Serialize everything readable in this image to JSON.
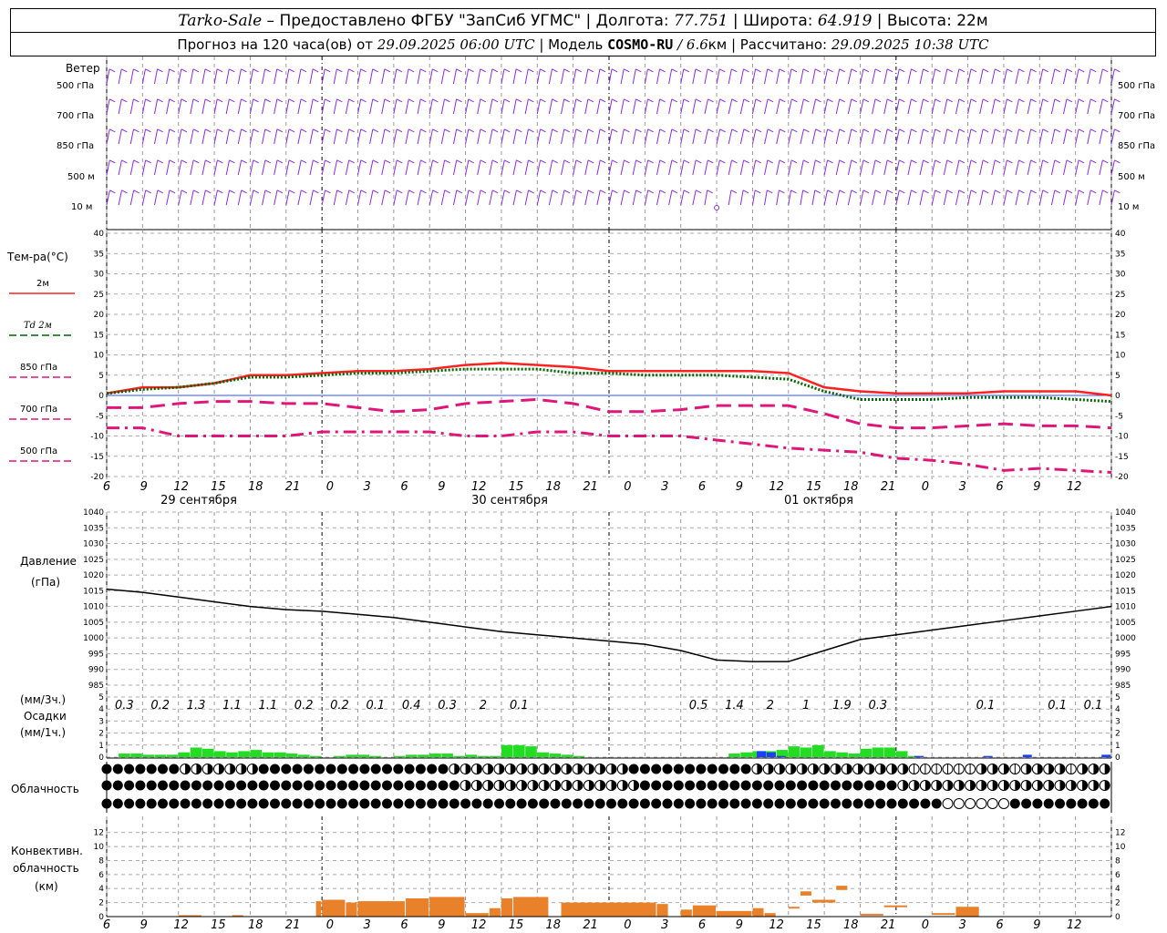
{
  "header": {
    "station": "Tarko-Sale",
    "provider": " – Предоставлено ФГБУ \"ЗапСиб УГМС\" | ",
    "lon_label": "Долгота: ",
    "lon": "77.751",
    "lat_label": " | Широта: ",
    "lat": "64.919",
    "alt_label": " | Высота: ",
    "alt": "22м",
    "forecast_label": "Прогноз на 120 часа(ов) от ",
    "forecast_time": "29.09.2025 06:00 UTC",
    "model_label": "  | Модель ",
    "model": "COSMO-RU",
    "res_sep": " / ",
    "res": "6.6",
    "res_unit": "км",
    "calc_label": " | Рассчитано: ",
    "calc_time": "29.09.2025 10:38 UTC"
  },
  "colors": {
    "wind": "#8a2be2",
    "t2m": "#ff2020",
    "td2m": "#006400",
    "t850": "#e0157a",
    "precip3": "#22dd22",
    "precip1": "#1a3fff",
    "convective": "#e8812a",
    "pressure": "#000000"
  },
  "panels": {
    "wind": {
      "title": "Ветер",
      "levels": [
        "500 гПа",
        "700 гПа",
        "850 гПа",
        "500 м",
        "10  м"
      ]
    },
    "temperature": {
      "title": "Тем-ра(°C)",
      "legend": [
        {
          "label": "2м",
          "style": "solid",
          "color": "#ff2020"
        },
        {
          "label": "Td  2м",
          "style": "dotted",
          "color": "#006400"
        },
        {
          "label": "850 гПа",
          "style": "solid",
          "color": "#e0157a"
        },
        {
          "label": "700 гПа",
          "style": "longdash",
          "color": "#e0157a"
        },
        {
          "label": "500 гПа",
          "style": "dashdot",
          "color": "#e0157a"
        }
      ]
    },
    "pressure": {
      "title": "Давление",
      "unit": "(гПа)"
    },
    "precip": {
      "unit3": "(мм/3ч.)",
      "title": "Осадки",
      "unit1": "(мм/1ч.)"
    },
    "clouds": {
      "title": "Облачность"
    },
    "convective": {
      "title": "Конвективн.",
      "title2": "облачность",
      "unit": "(км)"
    }
  },
  "x_axis": {
    "hour_labels": [
      "6",
      "9",
      "12",
      "15",
      "18",
      "21",
      "0",
      "3",
      "6",
      "9",
      "12",
      "15",
      "18",
      "21",
      "0",
      "3",
      "6",
      "9",
      "12",
      "15",
      "18",
      "21",
      "0",
      "3",
      "6",
      "9",
      "12"
    ],
    "date_labels": [
      "29 сентября",
      "30 сентября",
      "01 октября"
    ]
  },
  "chart_data": [
    {
      "type": "line",
      "title": "Тем-ра(°C)",
      "ylim": [
        -20,
        40
      ],
      "yticks": [
        -20,
        -15,
        -10,
        -5,
        0,
        5,
        10,
        15,
        20,
        25,
        30,
        35,
        40
      ],
      "x": [
        0,
        3,
        6,
        9,
        12,
        15,
        18,
        21,
        24,
        27,
        30,
        33,
        36,
        39,
        42,
        45,
        48,
        51,
        54,
        57,
        60,
        63,
        66,
        69,
        72,
        75,
        78
      ],
      "series": [
        {
          "name": "2м",
          "values": [
            0.5,
            2,
            2,
            3,
            5,
            5,
            5.5,
            6,
            6,
            6.5,
            7.5,
            8,
            7.5,
            7,
            6,
            6,
            6,
            6,
            6,
            5.5,
            2,
            1,
            0.5,
            0.5,
            0.5,
            1,
            1,
            1,
            0
          ]
        },
        {
          "name": "Td  2м",
          "values": [
            0.5,
            1.5,
            2,
            3,
            4.5,
            4.5,
            5,
            5.5,
            5.5,
            6,
            6.5,
            6.5,
            6.5,
            5.5,
            5.5,
            5,
            5,
            5,
            4.5,
            4,
            1,
            -1,
            -1,
            -1,
            -0.5,
            -0.5,
            -0.5,
            -1,
            -1.5
          ]
        },
        {
          "name": "850 гПа",
          "values": [
            -3,
            -3,
            -2,
            -1.5,
            -1.5,
            -2,
            -2,
            -3,
            -4,
            -3.5,
            -2,
            -1.5,
            -1,
            -2,
            -4,
            -4,
            -3.5,
            -2.5,
            -2.5,
            -2.5,
            -4.5,
            -7,
            -8,
            -8,
            -7.5,
            -7,
            -7.5,
            -7.5,
            -8
          ]
        },
        {
          "name": "700 гПа",
          "values": [
            -3,
            -3,
            -2,
            -1.5,
            -1.5,
            -2,
            -2,
            -3,
            -4,
            -3.5,
            -2,
            -1.5,
            -1,
            -2,
            -4,
            -4,
            -3.5,
            -2.5,
            -2.5,
            -2.5,
            -4.5,
            -7,
            -8,
            -8,
            -7.5,
            -7,
            -7.5,
            -7.5,
            -8
          ]
        },
        {
          "name": "500 гПа",
          "values": [
            -8,
            -8,
            -10,
            -10,
            -10,
            -10,
            -9,
            -9,
            -9,
            -9,
            -10,
            -10,
            -9,
            -9,
            -10,
            -10,
            -10,
            -11,
            -12,
            -13,
            -13.5,
            -14,
            -15.5,
            -16,
            -17,
            -18.5,
            -18,
            -18.5,
            -19
          ]
        }
      ],
      "x_hours": [
        0,
        3,
        6,
        9,
        12,
        15,
        18,
        21,
        24,
        27,
        30,
        33,
        36,
        39,
        42,
        45,
        48,
        51,
        54,
        57,
        60,
        63,
        66,
        69,
        72,
        75,
        78,
        81,
        84
      ]
    },
    {
      "type": "line",
      "title": "Давление",
      "ylabel": "(гПа)",
      "ylim": [
        985,
        1040
      ],
      "yticks": [
        985,
        990,
        995,
        1000,
        1005,
        1010,
        1015,
        1020,
        1025,
        1030,
        1035,
        1040
      ],
      "x_hours": [
        0,
        3,
        6,
        9,
        12,
        15,
        18,
        21,
        24,
        27,
        30,
        33,
        36,
        39,
        42,
        45,
        48,
        51,
        54,
        57,
        60,
        63,
        66,
        69,
        72,
        75,
        78,
        81,
        84
      ],
      "series": [
        {
          "name": "",
          "values": [
            1015.5,
            1014.5,
            1013,
            1011.5,
            1010,
            1009,
            1008.5,
            1007.5,
            1006.5,
            1005,
            1003.5,
            1002,
            1001,
            1000,
            999,
            998,
            996,
            993,
            992.5,
            992.5,
            996,
            999.5,
            1001,
            1002.5,
            1004,
            1005.5,
            1007,
            1008.5,
            1010
          ]
        }
      ]
    },
    {
      "type": "bar",
      "title": "Осадки",
      "ylim": [
        0,
        5
      ],
      "yticks": [
        0,
        1,
        2,
        3,
        4,
        5
      ],
      "labels_3h": [
        {
          "hour": 3,
          "value": "0.3"
        },
        {
          "hour": 6,
          "value": "0.2"
        },
        {
          "hour": 9,
          "value": "1.3"
        },
        {
          "hour": 12,
          "value": "1.1"
        },
        {
          "hour": 15,
          "value": "1.1"
        },
        {
          "hour": 18,
          "value": "0.2"
        },
        {
          "hour": 21,
          "value": "0.2"
        },
        {
          "hour": 24,
          "value": "0.1"
        },
        {
          "hour": 27,
          "value": "0.4"
        },
        {
          "hour": 30,
          "value": "0.3"
        },
        {
          "hour": 33,
          "value": "2"
        },
        {
          "hour": 36,
          "value": "0.1"
        },
        {
          "hour": 51,
          "value": "0.5"
        },
        {
          "hour": 54,
          "value": "1.4"
        },
        {
          "hour": 57,
          "value": "2"
        },
        {
          "hour": 60,
          "value": "1"
        },
        {
          "hour": 63,
          "value": "1.9"
        },
        {
          "hour": 66,
          "value": "0.3"
        },
        {
          "hour": 75,
          "value": "0.1"
        },
        {
          "hour": 81,
          "value": "0.1"
        },
        {
          "hour": 84,
          "value": "0.1"
        }
      ],
      "hourly_rain": [
        0,
        0.3,
        0.3,
        0.2,
        0.2,
        0.2,
        0.4,
        0.8,
        0.7,
        0.5,
        0.4,
        0.5,
        0.6,
        0.4,
        0.4,
        0.3,
        0.2,
        0.1,
        0,
        0.1,
        0.2,
        0.2,
        0.1,
        0,
        0.1,
        0.2,
        0.2,
        0.3,
        0.3,
        0.1,
        0.2,
        0.1,
        0.1,
        1,
        1,
        0.9,
        0.4,
        0.3,
        0.2,
        0.1,
        0,
        0,
        0,
        0,
        0,
        0,
        0,
        0,
        0,
        0,
        0,
        0,
        0.3,
        0.4,
        0.5,
        0.5,
        0.6,
        0.9,
        0.8,
        1,
        0.5,
        0.4,
        0.3,
        0.7,
        0.8,
        0.8,
        0.5,
        0.1,
        0,
        0,
        0,
        0,
        0,
        0,
        0,
        0,
        0,
        0,
        0,
        0,
        0,
        0,
        0,
        0,
        0
      ],
      "hourly_snow": [
        0,
        0,
        0,
        0,
        0,
        0,
        0,
        0,
        0,
        0,
        0,
        0,
        0,
        0,
        0,
        0,
        0,
        0,
        0,
        0,
        0,
        0,
        0,
        0,
        0,
        0,
        0,
        0,
        0,
        0,
        0,
        0,
        0,
        0,
        0,
        0,
        0,
        0,
        0,
        0,
        0,
        0,
        0,
        0,
        0,
        0,
        0,
        0,
        0,
        0,
        0,
        0,
        0,
        0,
        0,
        0,
        0,
        0,
        0,
        0,
        0,
        0,
        0,
        0,
        0,
        0,
        0.5,
        0.4,
        0.1,
        0,
        0,
        0,
        0,
        0,
        0,
        0,
        0,
        0,
        0,
        0,
        0,
        0,
        0.1,
        0,
        0,
        0,
        0,
        0,
        0,
        0.1,
        0,
        0,
        0,
        0.2,
        0,
        0,
        0,
        0,
        0,
        0,
        0,
        0.2
      ]
    },
    {
      "type": "bar",
      "title": "Конвективн. облачность",
      "ylabel": "(км)",
      "ylim": [
        0,
        13
      ],
      "yticks": [
        0,
        2,
        4,
        6,
        8,
        10,
        12
      ],
      "segments": [
        {
          "from": 6,
          "to": 8,
          "base": 0,
          "top": 0.2
        },
        {
          "from": 10.5,
          "to": 11.5,
          "base": 0,
          "top": 0.2
        },
        {
          "from": 17.5,
          "to": 18,
          "base": 0,
          "top": 2.2
        },
        {
          "from": 18,
          "to": 20,
          "base": 0,
          "top": 2.4
        },
        {
          "from": 20,
          "to": 21,
          "base": 0,
          "top": 2.0
        },
        {
          "from": 21,
          "to": 25,
          "base": 0,
          "top": 2.2
        },
        {
          "from": 25,
          "to": 27,
          "base": 0,
          "top": 2.6
        },
        {
          "from": 27,
          "to": 30,
          "base": 0,
          "top": 2.8
        },
        {
          "from": 30,
          "to": 32,
          "base": 0,
          "top": 0.5
        },
        {
          "from": 32,
          "to": 33,
          "base": 0,
          "top": 1.2
        },
        {
          "from": 33,
          "to": 34,
          "base": 0,
          "top": 2.6
        },
        {
          "from": 34,
          "to": 37,
          "base": 0,
          "top": 2.8
        },
        {
          "from": 38,
          "to": 46,
          "base": 0,
          "top": 2.0
        },
        {
          "from": 46,
          "to": 47,
          "base": 0,
          "top": 1.8
        },
        {
          "from": 48,
          "to": 49,
          "base": 0,
          "top": 1.0
        },
        {
          "from": 49,
          "to": 51,
          "base": 0,
          "top": 1.6
        },
        {
          "from": 51,
          "to": 54,
          "base": 0,
          "top": 0.8
        },
        {
          "from": 54,
          "to": 55,
          "base": 0,
          "top": 1.2
        },
        {
          "from": 55,
          "to": 56,
          "base": 0,
          "top": 0.5
        },
        {
          "from": 57,
          "to": 58,
          "base": 1.2,
          "top": 1.4
        },
        {
          "from": 58,
          "to": 59,
          "base": 3.0,
          "top": 3.6
        },
        {
          "from": 59,
          "to": 61,
          "base": 2.0,
          "top": 2.4
        },
        {
          "from": 61,
          "to": 62,
          "base": 3.8,
          "top": 4.4
        },
        {
          "from": 63,
          "to": 65,
          "base": 0.2,
          "top": 0.4
        },
        {
          "from": 65,
          "to": 67,
          "base": 1.4,
          "top": 1.6
        },
        {
          "from": 69,
          "to": 71,
          "base": 0.3,
          "top": 0.5
        },
        {
          "from": 71,
          "to": 73,
          "base": 0,
          "top": 1.4
        }
      ],
      "x_offset_hours": 0
    }
  ],
  "clouds_rows": [
    "FFFFFFFHHHHHHHFFFFFFFFFFFFFFFFFHHHHHHHHHHHHHHHHFFFFFFFFFFFHHHHHHHHHHHHHHTTTTTTHHHTHHHHTHHH",
    "FFFFFFFFFFFFFFFFFFFFFFFFFFFFFFFFHHHHHHHHHHHHHHHHFFFFFFFFFFFFFFFFFFFFFFFHHHHHHHHHHHHHHHHHHHHH",
    "FFFFFFFFFFFFFFFFFFFFFFFFFFFFFFFFFFFFFFFFFFFFFFFFFFFFFFFFFFFFFFFFFFFFFFFFFFFEEEEEEFFFFFFFFFFFF"
  ]
}
